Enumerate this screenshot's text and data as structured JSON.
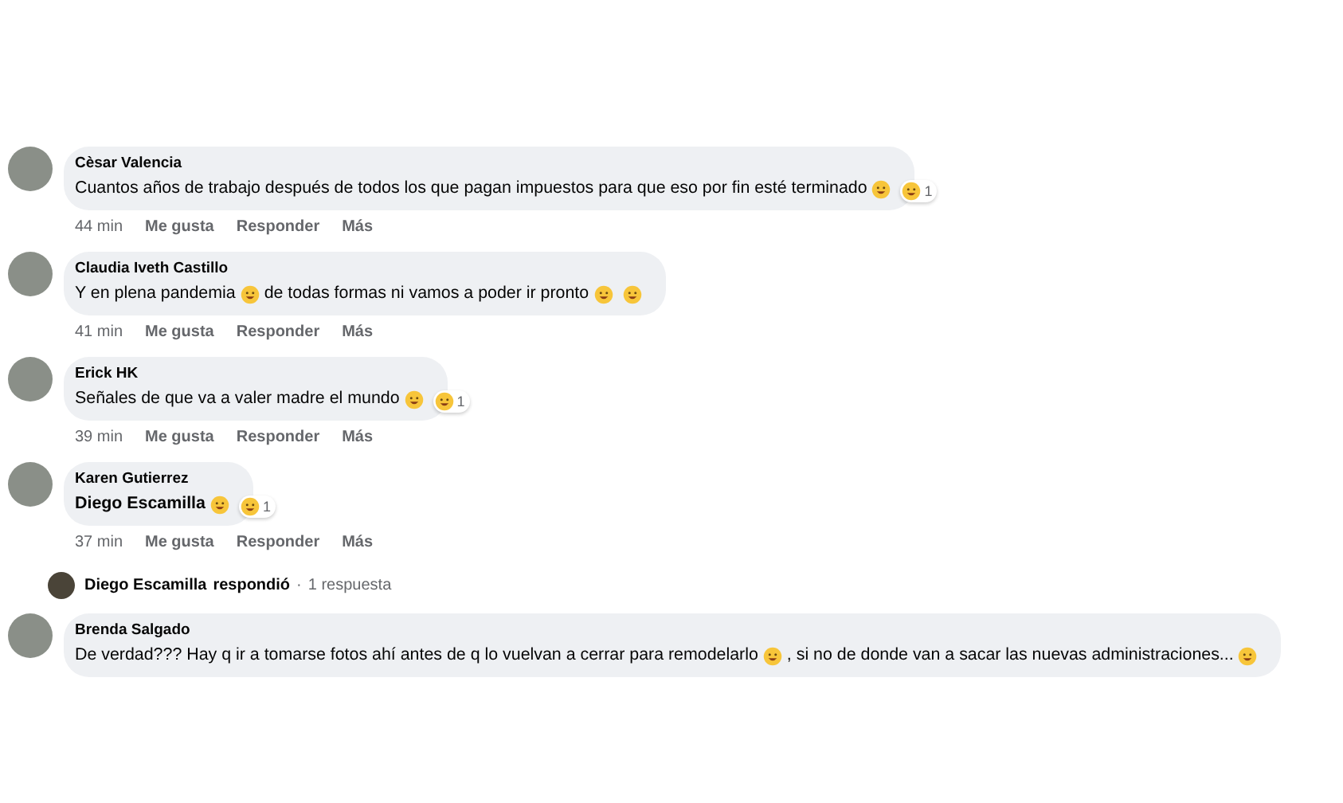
{
  "comments": [
    {
      "author": "Cèsar Valencia",
      "mention": false,
      "parts": [
        {
          "kind": "text",
          "text": "Cuantos años de trabajo después de todos los que pagan impuestos para que eso por fin esté terminado"
        },
        {
          "kind": "emoji"
        }
      ],
      "reaction": {
        "count": "1"
      },
      "actions": {
        "time": "44 min",
        "like": "Me gusta",
        "reply": "Responder",
        "more": "Más"
      }
    },
    {
      "author": "Claudia Iveth Castillo",
      "mention": false,
      "parts": [
        {
          "kind": "text",
          "text": "Y en plena pandemia"
        },
        {
          "kind": "emoji"
        },
        {
          "kind": "text",
          "text": "de todas formas ni vamos a poder ir pronto"
        },
        {
          "kind": "emoji"
        },
        {
          "kind": "emoji"
        }
      ],
      "actions": {
        "time": "41 min",
        "like": "Me gusta",
        "reply": "Responder",
        "more": "Más"
      }
    },
    {
      "author": "Erick HK",
      "mention": false,
      "parts": [
        {
          "kind": "text",
          "text": "Señales de que va a valer madre el mundo"
        },
        {
          "kind": "emoji"
        }
      ],
      "reaction": {
        "count": "1"
      },
      "actions": {
        "time": "39 min",
        "like": "Me gusta",
        "reply": "Responder",
        "more": "Más"
      }
    },
    {
      "author": "Karen Gutierrez",
      "mention": true,
      "parts": [
        {
          "kind": "text",
          "text": "Diego Escamilla"
        },
        {
          "kind": "emoji"
        }
      ],
      "reaction": {
        "count": "1"
      },
      "actions": {
        "time": "37 min",
        "like": "Me gusta",
        "reply": "Responder",
        "more": "Más"
      },
      "replies": {
        "author": "Diego Escamilla",
        "verb": "respondió",
        "separator": "·",
        "count": "1 respuesta"
      }
    },
    {
      "author": "Brenda Salgado",
      "mention": false,
      "parts": [
        {
          "kind": "text",
          "text": "De verdad??? Hay q ir a tomarse fotos ahí antes de q lo vuelvan a cerrar para remodelarlo"
        },
        {
          "kind": "emoji"
        },
        {
          "kind": "text",
          "text": ", si no de donde van a sacar las nuevas administraciones..."
        },
        {
          "kind": "emoji"
        }
      ]
    }
  ]
}
